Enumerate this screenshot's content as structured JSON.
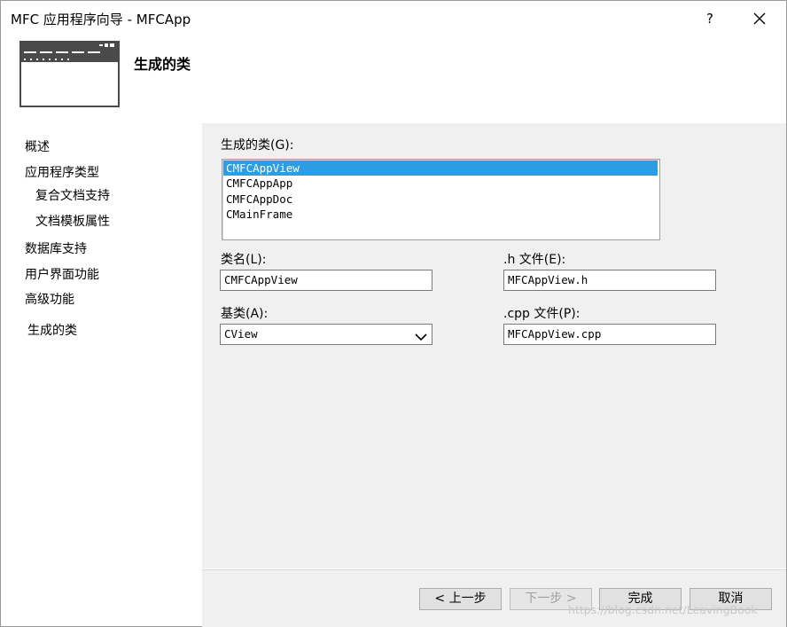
{
  "window": {
    "title": "MFC 应用程序向导 - MFCApp",
    "help_label": "?"
  },
  "header": {
    "title": "生成的类"
  },
  "sidebar": {
    "items": [
      {
        "label": "概述"
      },
      {
        "label": "应用程序类型"
      },
      {
        "label": "复合文档支持"
      },
      {
        "label": "文档模板属性"
      },
      {
        "label": "数据库支持"
      },
      {
        "label": "用户界面功能"
      },
      {
        "label": "高级功能"
      },
      {
        "label": "生成的类"
      }
    ]
  },
  "main": {
    "classes_label": "生成的类(G):",
    "classes": [
      "CMFCAppView",
      "CMFCAppApp",
      "CMFCAppDoc",
      "CMainFrame"
    ],
    "selected_class": "CMFCAppView",
    "class_name_label": "类名(L):",
    "class_name_value": "CMFCAppView",
    "h_file_label": ".h 文件(E):",
    "h_file_value": "MFCAppView.h",
    "base_class_label": "基类(A):",
    "base_class_value": "CView",
    "cpp_file_label": ".cpp 文件(P):",
    "cpp_file_value": "MFCAppView.cpp"
  },
  "footer": {
    "back_label": "< 上一步",
    "next_label": "下一步 >",
    "finish_label": "完成",
    "cancel_label": "取消"
  },
  "watermark": "https://blog.csdn.net/LeavingBook",
  "colors": {
    "selection": "#2d9ce0",
    "panel": "#f0f0f0"
  }
}
